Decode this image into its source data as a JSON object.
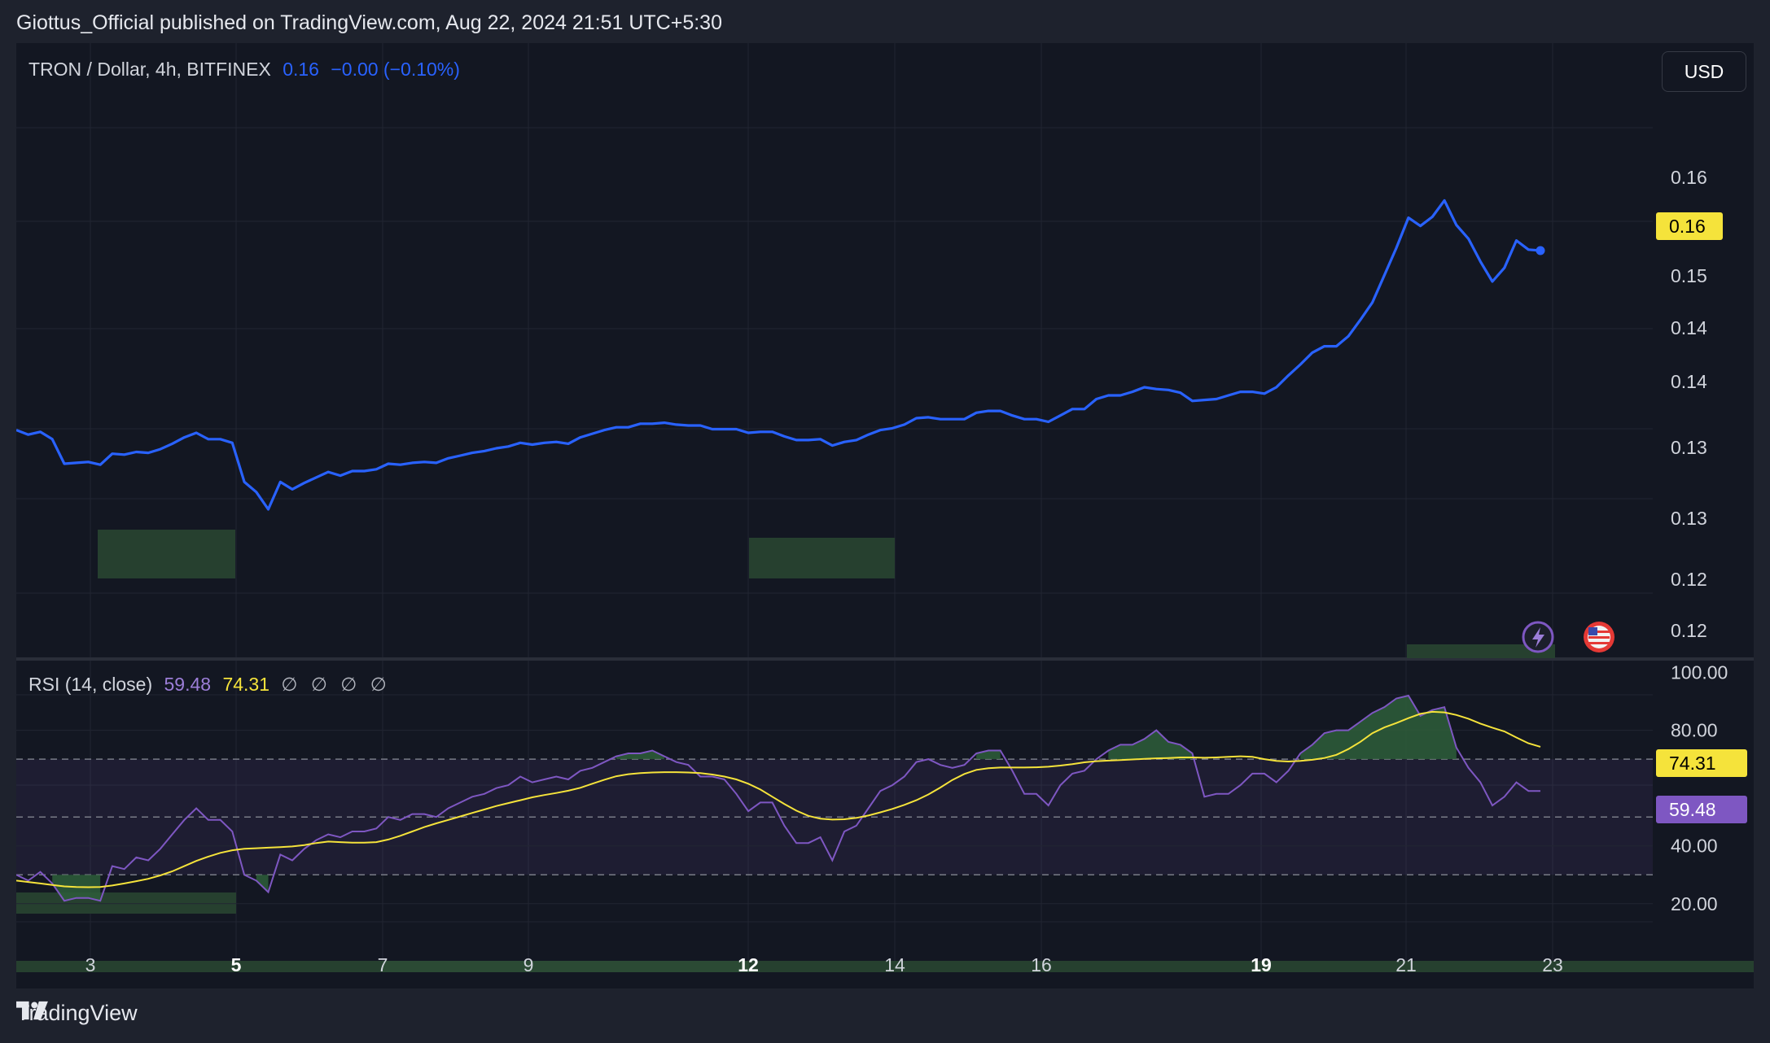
{
  "header": {
    "caption": "Giottus_Official published on TradingView.com, Aug 22, 2024 21:51 UTC+5:30"
  },
  "symbol_legend": {
    "symbol": "TRON / Dollar, 4h, BITFINEX",
    "price": "0.16",
    "change": "−0.00 (−0.10%)"
  },
  "currency_button": "USD",
  "rsi_legend": {
    "label": "RSI (14, close)",
    "rsi": "59.48",
    "ma": "74.31",
    "placeholders": [
      "∅",
      "∅",
      "∅",
      "∅"
    ]
  },
  "footer": {
    "brand": "TradingView"
  },
  "colors": {
    "price_line": "#2962ff",
    "rsi_line": "#7e57c2",
    "rsi_ma": "#f5e33b",
    "price_badge": "#f5e33b",
    "rsi_badge": "#7e57c2",
    "zone_fill": "#26402f"
  },
  "chart_data": [
    {
      "type": "line",
      "name": "price",
      "x_axis": {
        "tick_labels": [
          "3",
          "5",
          "7",
          "9",
          "12",
          "14",
          "16",
          "19",
          "21",
          "23"
        ],
        "bold_ticks": [
          "5",
          "12",
          "19"
        ]
      },
      "y_axis": {
        "tick_labels": [
          "0.16",
          "0.15",
          "0.14",
          "0.14",
          "0.13",
          "0.13",
          "0.12",
          "0.12"
        ]
      },
      "last_value_label": "0.16",
      "values": [
        0.128,
        0.1275,
        0.1278,
        0.127,
        0.1243,
        0.1244,
        0.1245,
        0.1242,
        0.1254,
        0.1253,
        0.1256,
        0.1255,
        0.1259,
        0.1265,
        0.1272,
        0.1277,
        0.127,
        0.127,
        0.1266,
        0.1223,
        0.1212,
        0.1193,
        0.1223,
        0.1215,
        0.1222,
        0.1228,
        0.1234,
        0.123,
        0.1235,
        0.1235,
        0.1237,
        0.1243,
        0.1242,
        0.1244,
        0.1245,
        0.1244,
        0.1249,
        0.1252,
        0.1255,
        0.1257,
        0.126,
        0.1262,
        0.1266,
        0.1264,
        0.1266,
        0.1267,
        0.1265,
        0.1272,
        0.1276,
        0.128,
        0.1283,
        0.1283,
        0.1287,
        0.1287,
        0.1288,
        0.1286,
        0.1285,
        0.1285,
        0.1281,
        0.1281,
        0.1281,
        0.1277,
        0.1278,
        0.1278,
        0.1273,
        0.1269,
        0.1269,
        0.127,
        0.1263,
        0.1267,
        0.1269,
        0.1275,
        0.128,
        0.1282,
        0.1286,
        0.1293,
        0.1294,
        0.1292,
        0.1292,
        0.1292,
        0.1299,
        0.1301,
        0.1301,
        0.1296,
        0.1292,
        0.1292,
        0.1289,
        0.1296,
        0.1303,
        0.1303,
        0.1314,
        0.1318,
        0.1318,
        0.1322,
        0.1327,
        0.1325,
        0.1324,
        0.1321,
        0.1312,
        0.1313,
        0.1314,
        0.1318,
        0.1322,
        0.1322,
        0.132,
        0.1327,
        0.134,
        0.1352,
        0.1365,
        0.1372,
        0.1372,
        0.1383,
        0.1401,
        0.142,
        0.145,
        0.148,
        0.1513,
        0.1504,
        0.1514,
        0.1532,
        0.1505,
        0.149,
        0.1465,
        0.1443,
        0.1458,
        0.1488,
        0.1478,
        0.1477
      ]
    },
    {
      "type": "line",
      "name": "RSI (14, close)",
      "y_axis": {
        "tick_labels": [
          "100.00",
          "80.00",
          "40.00",
          "20.00"
        ],
        "bands": [
          30,
          50,
          70
        ],
        "ylim": [
          16,
          101
        ]
      },
      "last_value_labels": {
        "rsi": "59.48",
        "ma": "74.31"
      },
      "rsi": [
        30,
        28,
        31,
        27,
        21,
        22,
        22,
        21,
        33,
        32,
        36,
        35,
        39,
        44,
        49,
        53,
        49,
        49,
        45,
        30,
        28,
        24,
        37,
        35,
        39,
        42,
        44,
        43,
        45,
        45,
        46,
        50,
        49,
        51,
        51,
        50,
        53,
        55,
        57,
        58,
        60,
        61,
        64,
        62,
        63,
        64,
        63,
        66,
        67,
        69,
        71,
        72,
        72,
        73,
        71,
        69,
        68,
        64,
        64,
        63,
        58,
        52,
        55,
        55,
        47,
        41,
        41,
        43,
        35,
        45,
        47,
        53,
        59,
        61,
        64,
        69,
        70,
        68,
        67,
        68,
        72,
        73,
        73,
        66,
        58,
        58,
        54,
        61,
        65,
        66,
        70,
        73,
        75,
        75,
        77,
        80,
        76,
        75,
        72,
        57,
        58,
        58,
        61,
        65,
        65,
        62,
        66,
        72,
        75,
        79,
        80,
        80,
        83,
        86,
        88,
        91,
        92,
        85,
        87,
        88,
        74,
        67,
        62,
        54,
        57,
        62,
        59,
        59
      ],
      "ma": [
        28,
        27.5,
        27,
        26.5,
        26,
        25.8,
        25.7,
        25.8,
        26.3,
        27,
        27.8,
        28.6,
        29.8,
        31.2,
        33,
        34.8,
        36.3,
        37.6,
        38.5,
        39,
        39.2,
        39.4,
        39.6,
        39.8,
        40.3,
        41,
        41.5,
        41.3,
        41.1,
        41.1,
        41.3,
        42.2,
        43.5,
        45,
        46.5,
        47.8,
        49,
        50.2,
        51.4,
        52.6,
        53.8,
        54.8,
        55.8,
        56.8,
        57.6,
        58.3,
        59.1,
        60.1,
        61.5,
        62.9,
        64.1,
        64.8,
        65.2,
        65.4,
        65.5,
        65.5,
        65.4,
        65.2,
        64.7,
        64,
        63,
        61.5,
        59.5,
        57,
        54.5,
        52.2,
        50.4,
        49.4,
        49.1,
        49.2,
        49.7,
        50.5,
        51.6,
        52.8,
        54.2,
        55.8,
        57.8,
        60.2,
        62.8,
        64.9,
        66.3,
        66.9,
        67.1,
        67.1,
        67.1,
        67.2,
        67.4,
        67.8,
        68.3,
        68.9,
        69.3,
        69.5,
        69.7,
        69.9,
        70.1,
        70.3,
        70.4,
        70.6,
        70.6,
        70.5,
        70.6,
        70.8,
        71,
        70.8,
        70,
        69.4,
        69.2,
        69.4,
        69.8,
        70.4,
        71.5,
        73.5,
        76,
        79,
        81,
        82.5,
        84.2,
        85.7,
        86.4,
        86.2,
        85.3,
        84,
        82.3,
        80.9,
        79.6,
        77.5,
        75.5,
        74.3
      ]
    }
  ]
}
